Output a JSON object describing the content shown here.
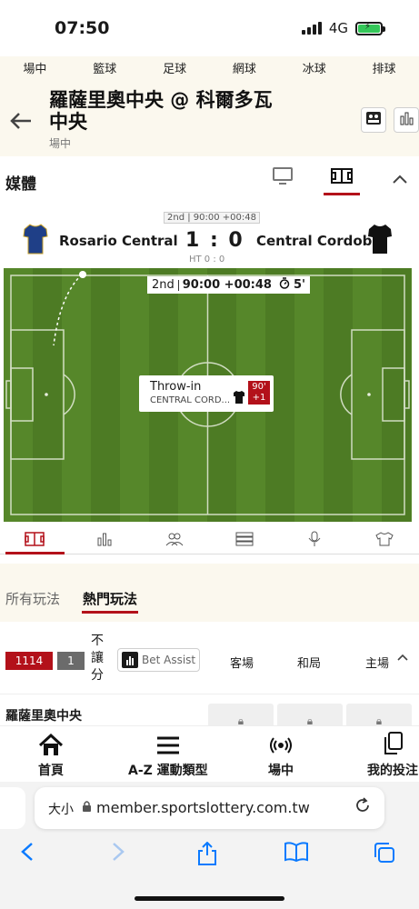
{
  "status": {
    "time": "07:50",
    "network": "4G"
  },
  "sport_tabs": [
    "場中",
    "籃球",
    "足球",
    "網球",
    "冰球",
    "排球"
  ],
  "header": {
    "title": "羅薩里奧中央 @ 科爾多瓦中央",
    "subtitle": "場中"
  },
  "media": {
    "label": "媒體"
  },
  "match": {
    "period_pill": "2nd | 90:00 +00:48",
    "home_team": "Rosario Central",
    "away_team": "Central Cordoba",
    "score": "1 : 0",
    "halftime": "HT 0 : 0",
    "home_color": "#1f3f87",
    "away_color": "#111111"
  },
  "pitch": {
    "period": "2nd",
    "clock": "90:00 +00:48",
    "timer": "5'",
    "event_title": "Throw-in",
    "event_team": "CENTRAL CORD...",
    "event_minute": "90'",
    "event_extra": "+1"
  },
  "market_tabs": {
    "all": "所有玩法",
    "hot": "熱門玩法"
  },
  "market": {
    "count_red": "1114",
    "count_grey": "1",
    "vertical_label": "不讓分",
    "bet_assist": "Bet Assist",
    "col_home": "客場",
    "col_draw": "和局",
    "col_away": "主場",
    "row_team": "羅薩里奧中央"
  },
  "bottom_nav": {
    "home": "首頁",
    "az": "A-Z 運動類型",
    "live": "場中",
    "bets": "我的投注"
  },
  "browser": {
    "aa": "大小",
    "url": "member.sportslottery.com.tw"
  },
  "colors": {
    "accent": "#b3111a",
    "pitch_green": "#5a8a2a"
  }
}
